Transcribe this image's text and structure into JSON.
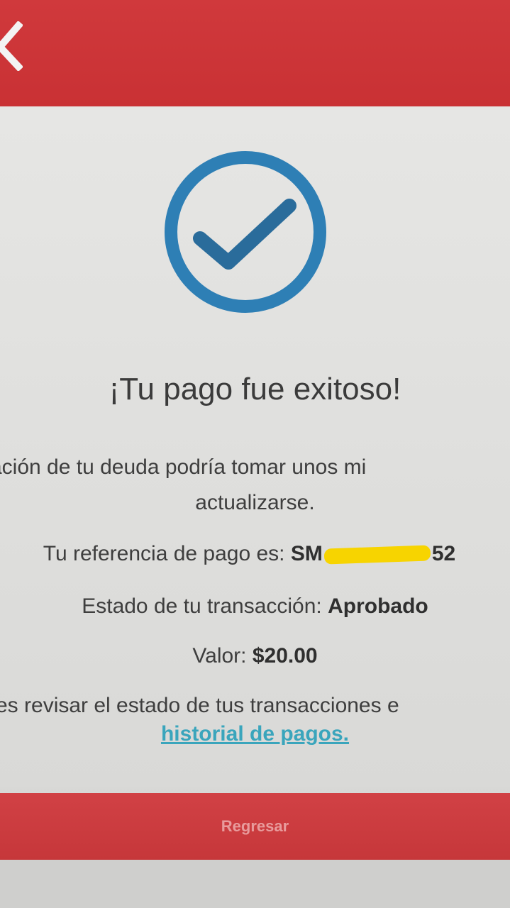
{
  "colors": {
    "brand_red": "#cc3538",
    "check_blue": "#2e7fb5",
    "link_teal": "#3aa5bc",
    "redaction_yellow": "#f7d400"
  },
  "header": {
    "back_icon": "chevron-left-icon"
  },
  "status": {
    "icon": "check-circle-icon",
    "title": "¡Tu pago fue exitoso!"
  },
  "message": {
    "line1": "ación de tu deuda podría tomar unos mi",
    "line2": "actualizarse."
  },
  "reference": {
    "label": "Tu referencia de pago es:",
    "value_prefix": "SM",
    "value_suffix": "52"
  },
  "transaction": {
    "label": "Estado de tu transacción:",
    "value": "Aprobado"
  },
  "amount": {
    "label": "Valor:",
    "value": "$20.00"
  },
  "history": {
    "text": "es revisar el estado de tus transacciones e",
    "link": "historial de pagos."
  },
  "actions": {
    "back_label": "Regresar"
  }
}
